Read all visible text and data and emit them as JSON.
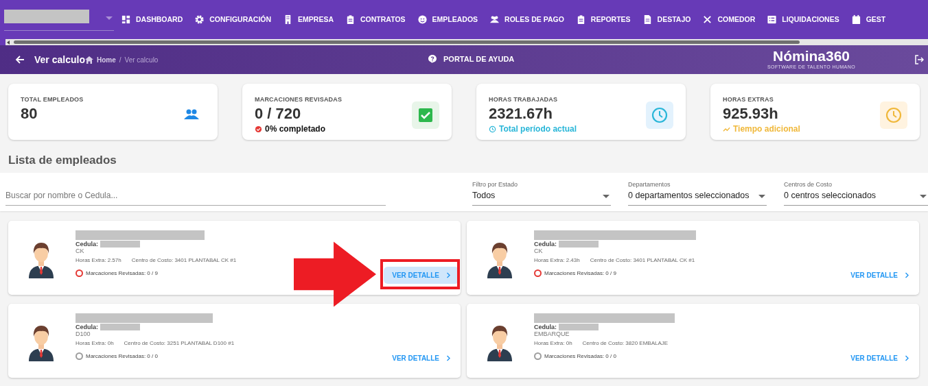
{
  "nav": {
    "items": [
      {
        "label": "DASHBOARD",
        "kind": "dashboard"
      },
      {
        "label": "CONFIGURACIÓN",
        "kind": "gear"
      },
      {
        "label": "EMPRESA",
        "kind": "building"
      },
      {
        "label": "CONTRATOS",
        "kind": "clipboard"
      },
      {
        "label": "EMPLEADOS",
        "kind": "face"
      },
      {
        "label": "ROLES DE PAGO",
        "kind": "people"
      },
      {
        "label": "REPORTES",
        "kind": "clipboard"
      },
      {
        "label": "DESTAJO",
        "kind": "document"
      },
      {
        "label": "COMEDOR",
        "kind": "cutlery"
      },
      {
        "label": "LIQUIDACIONES",
        "kind": "list"
      },
      {
        "label": "GEST",
        "kind": "calendar"
      }
    ]
  },
  "header": {
    "title": "Ver calculo",
    "breadcrumb": [
      "Home",
      "Ver calculo"
    ],
    "breadcrumb_separator": "/",
    "help": "PORTAL DE AYUDA",
    "logo": "Nómina360",
    "logo_tagline": "SOFTWARE DE TALENTO HUMANO"
  },
  "stats": [
    {
      "kind": "people",
      "label": "TOTAL EMPLEADOS",
      "value": "80"
    },
    {
      "kind": "check",
      "label": "MARCACIONES REVISADAS",
      "value": "0 / 720",
      "subtitle": "0% completado"
    },
    {
      "kind": "clock",
      "label": "HORAS TRABAJADAS",
      "value": "2321.67h",
      "subtitle": "Total período actual"
    },
    {
      "kind": "extra",
      "label": "HORAS EXTRAS",
      "value": "925.93h",
      "subtitle": "Tiempo adicional"
    }
  ],
  "section_title": "Lista de empleados",
  "filters": {
    "search": {
      "placeholder": "Buscar por nombre o Cedula..."
    },
    "selects": [
      {
        "label": "Filtro por Estado",
        "value": "Todos"
      },
      {
        "label": "Departamentos",
        "value": "0 departamentos seleccionados"
      },
      {
        "label": "Centros de Costo",
        "value": "0 centros seleccionados"
      }
    ]
  },
  "employees": [
    {
      "cedula_label": "Cedula:",
      "department": "CK",
      "horas_extra": "Horas Extra: 2.57h",
      "centro": "Centro de Costo: 3401 PLANTABAL CK #1",
      "marcaciones": "Marcaciones Revisadas: 0 / 9",
      "color": "#e53935",
      "button": "VER DETALLE",
      "highlighted": true
    },
    {
      "cedula_label": "Cedula:",
      "department": "CK",
      "horas_extra": "Horas Extra: 2.43h",
      "centro": "Centro de Costo: 3401 PLANTABAL CK #1",
      "marcaciones": "Marcaciones Revisadas: 0 / 9",
      "color": "#e53935",
      "button": "VER DETALLE",
      "highlighted": false
    },
    {
      "cedula_label": "Cedula:",
      "department": "D100",
      "horas_extra": "Horas Extra: 0h",
      "centro": "Centro de Costo: 3251 PLANTABAL D100 #1",
      "marcaciones": "Marcaciones Revisadas: 0 / 0",
      "color": "#9e9e9e",
      "button": "VER DETALLE",
      "highlighted": false
    },
    {
      "cedula_label": "Cedula:",
      "department": "EMBARQUE",
      "horas_extra": "Horas Extra: 0h",
      "centro": "Centro de Costo: 3820 EMBALAJE",
      "marcaciones": "Marcaciones Revisadas: 0 / 0",
      "color": "#9e9e9e",
      "button": "VER DETALLE",
      "highlighted": false
    }
  ]
}
